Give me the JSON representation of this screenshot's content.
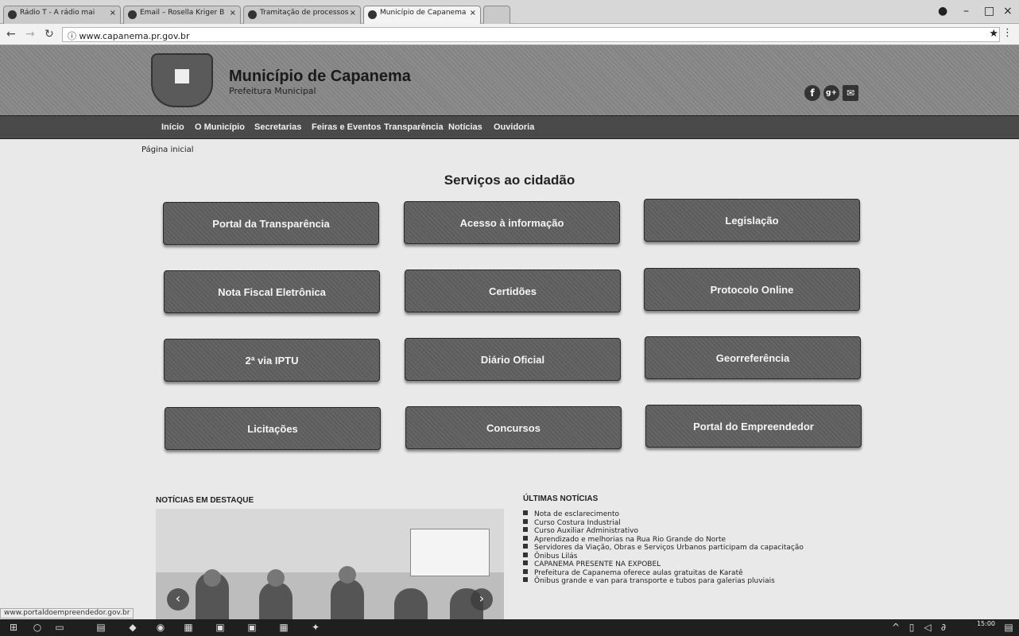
{
  "browser": {
    "tabs": [
      {
        "label": "Rádio T - A rádio mai"
      },
      {
        "label": "Email – Rosella Kriger B"
      },
      {
        "label": "Tramitação de processos"
      },
      {
        "label": "Município de Capanema"
      }
    ],
    "url": "www.capanema.pr.gov.br"
  },
  "site": {
    "title": "Município de Capanema",
    "subtitle": "Prefeitura Municipal",
    "social": {
      "facebook": "f",
      "google": "g+",
      "email": "✉"
    }
  },
  "nav": [
    "Início",
    "O Município",
    "Secretarias",
    "Feiras e Eventos",
    "Transparência",
    "Notícias",
    "Ouvidoria"
  ],
  "breadcrumb": "Página inicial",
  "services": {
    "title": "Serviços ao cidadão",
    "items": [
      "Portal da Transparência",
      "Acesso à informação",
      "Legislação",
      "Nota Fiscal Eletrônica",
      "Certidões",
      "Protocolo Online",
      "2ª via IPTU",
      "Diário Oficial",
      "Georreferência",
      "Licitações",
      "Concursos",
      "Portal do Empreendedor"
    ]
  },
  "featured": {
    "title": "NOTÍCIAS EM DESTAQUE"
  },
  "latest": {
    "title": "ÚLTIMAS NOTÍCIAS",
    "items": [
      "Nota de esclarecimento",
      "Curso Costura Industrial",
      "Curso Auxiliar Administrativo",
      "Aprendizado e melhorias na Rua Rio Grande do Norte",
      "Servidores da Viação, Obras e Serviços Urbanos participam da capacitação",
      "Ônibus Lilás",
      "CAPANEMA PRESENTE NA EXPOBEL",
      "Prefeitura de Capanema oferece aulas gratuitas de Karatê",
      "Ônibus grande e van para transporte e tubos para galerias pluviais"
    ]
  },
  "status_url": "www.portaldoempreendedor.gov.br",
  "taskbar": {
    "time": "15:00"
  }
}
